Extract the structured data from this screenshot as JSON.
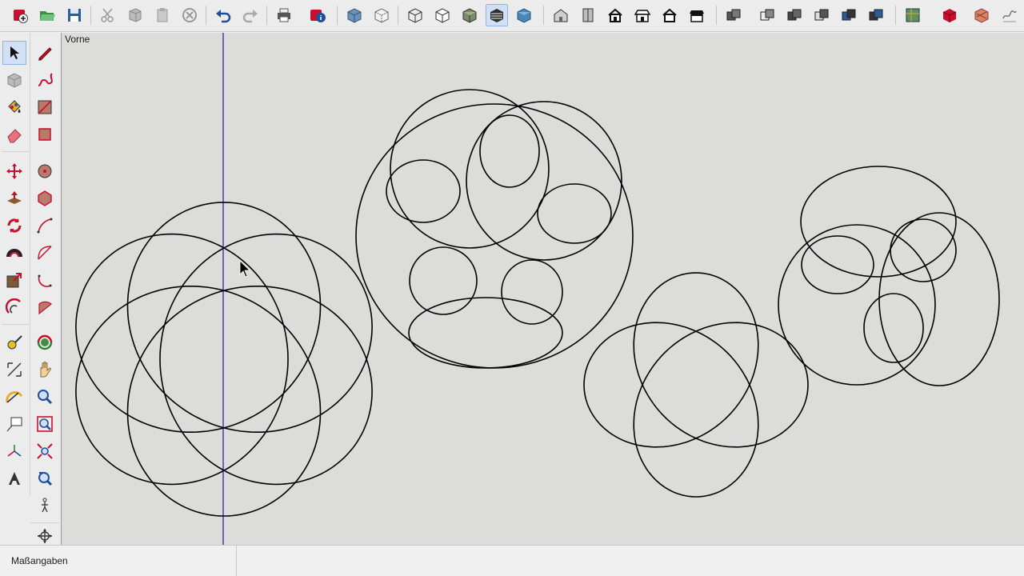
{
  "viewport": {
    "scene_label": "Vorne"
  },
  "statusbar": {
    "measurements_label": "Maßangaben",
    "measurements_value": ""
  },
  "toolbar": {
    "buttons": [
      "new-model-icon",
      "open-icon",
      "save-icon",
      "cut-icon",
      "copy-icon",
      "paste-icon",
      "erase-icon",
      "undo-icon",
      "redo-icon",
      "print-icon",
      "model-info-icon",
      "xray-icon",
      "back-edges-icon",
      "wireframe-icon",
      "hidden-line-icon",
      "shaded-icon",
      "shaded-textures-icon",
      "monochrome-icon",
      "iso-view-icon",
      "top-view-icon",
      "front-view-icon",
      "right-view-icon",
      "back-view-icon",
      "left-view-icon",
      "style-1-icon",
      "style-2-icon",
      "style-3-icon",
      "style-4-icon",
      "style-5-icon",
      "style-6-icon",
      "geo-location-icon",
      "warehouse-icon",
      "extension-icon",
      "sandbox-icon"
    ]
  },
  "colors": {
    "viewport_bg": "#dcdcda",
    "curve": "#000000",
    "axis_line": "#1b1b8a",
    "active_tool_bg": "#cfe0f7"
  }
}
